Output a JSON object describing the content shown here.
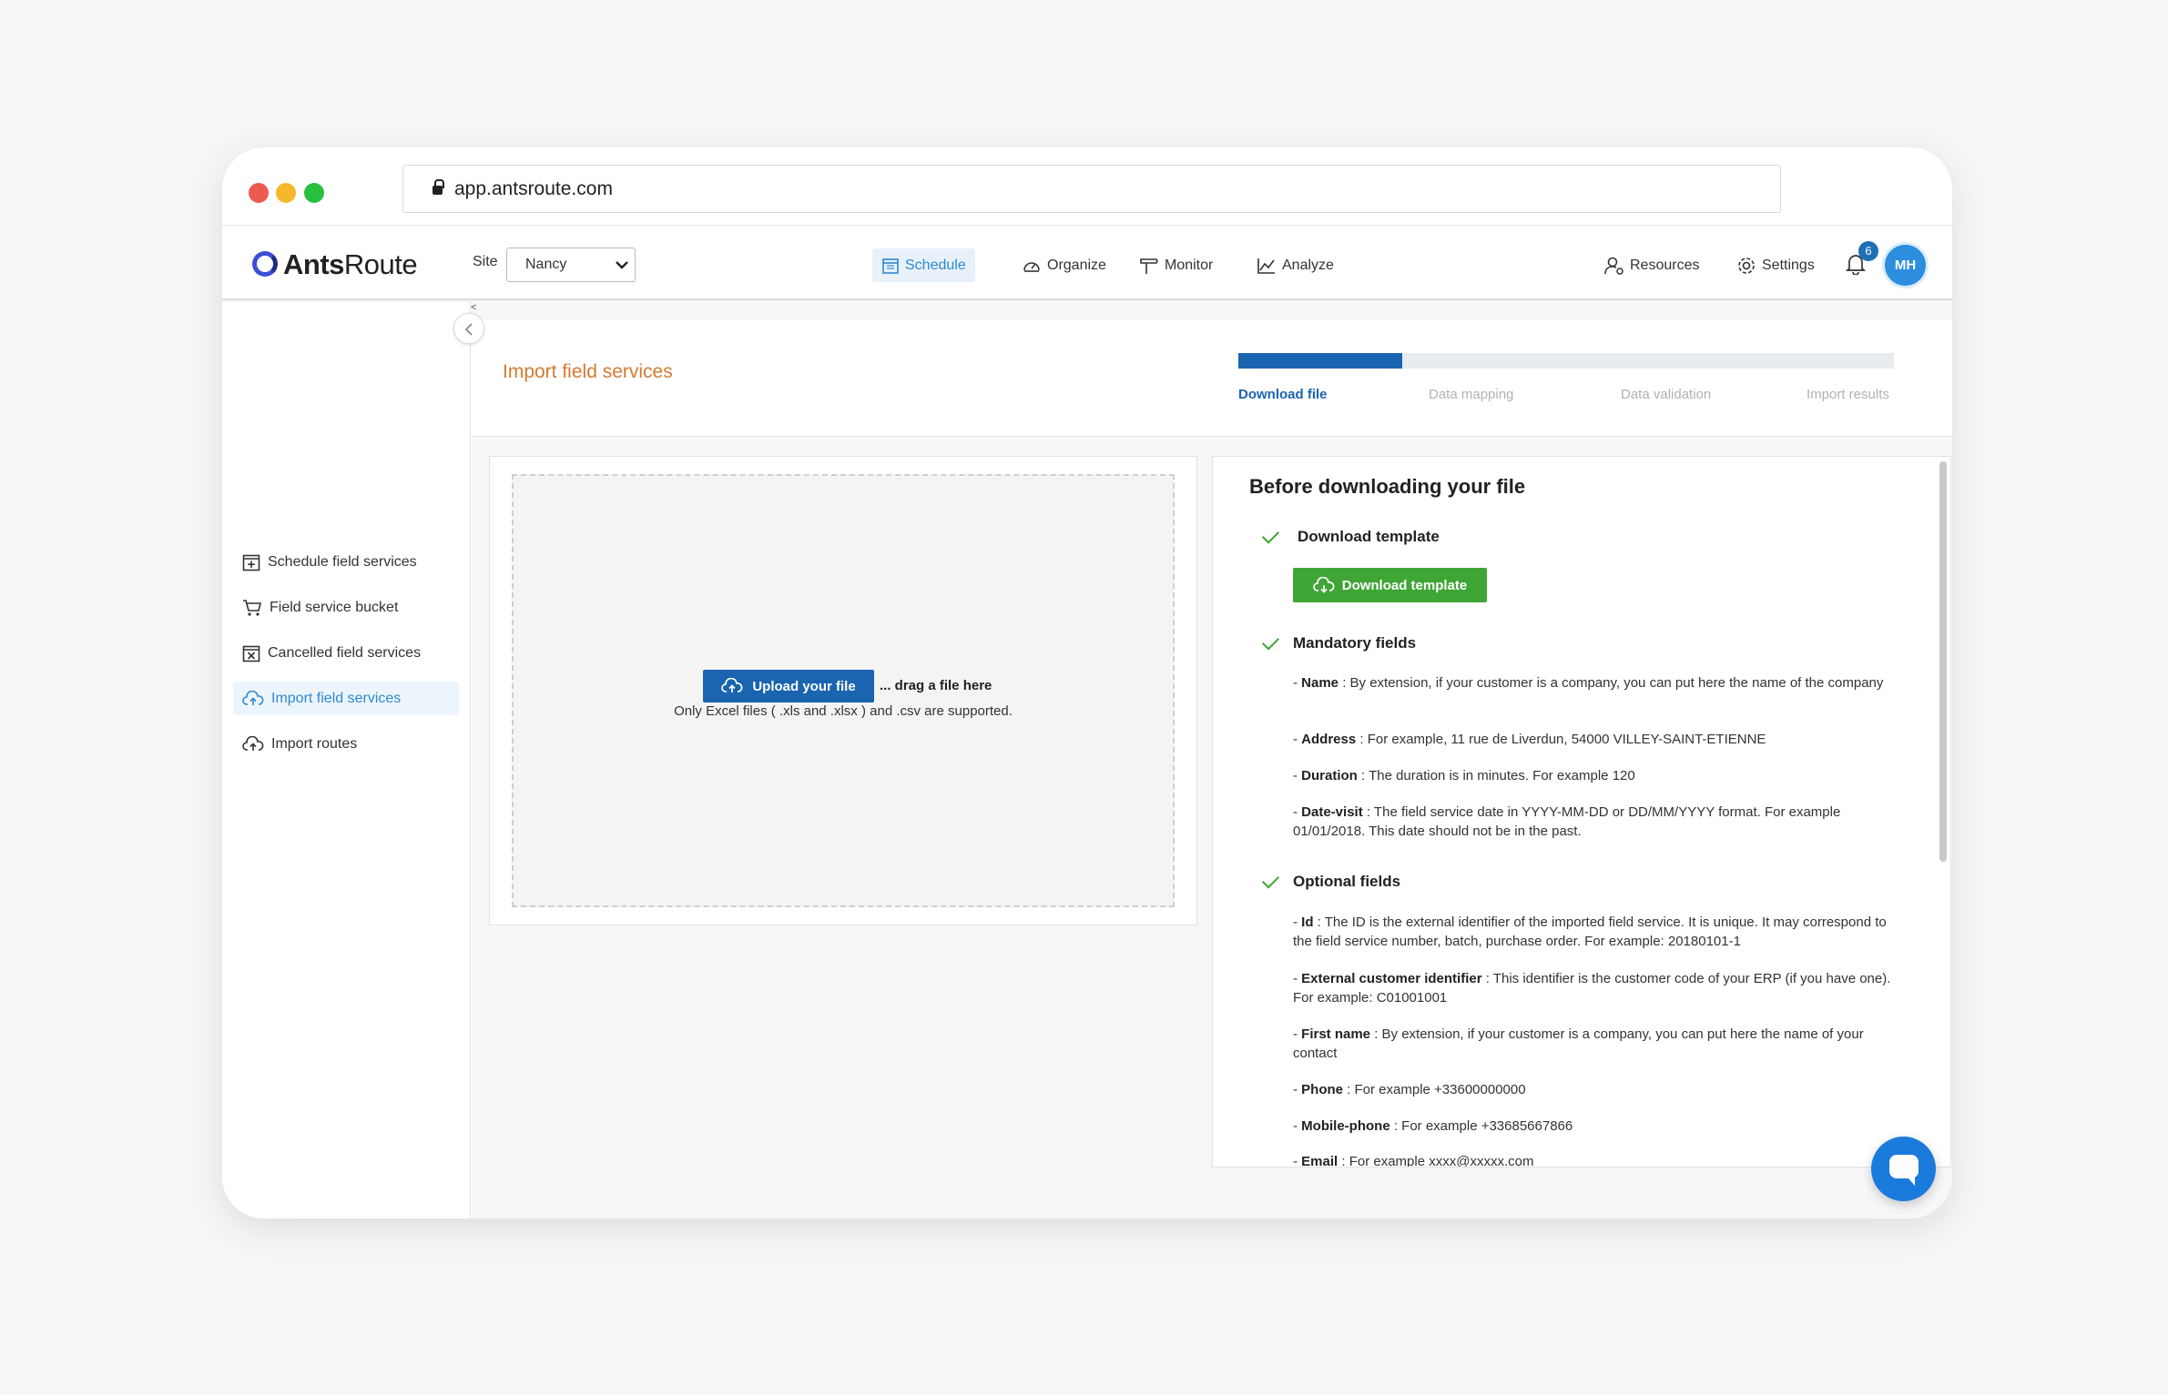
{
  "browser": {
    "url": "app.antsroute.com"
  },
  "app": {
    "logo_bold": "Ants",
    "logo_light": "Route"
  },
  "topnav": {
    "site_label": "Site",
    "site_value": "Nancy",
    "items": [
      {
        "label": "Schedule",
        "icon": "calendar-icon",
        "active": true
      },
      {
        "label": "Organize",
        "icon": "gauge-icon",
        "active": false
      },
      {
        "label": "Monitor",
        "icon": "signpost-icon",
        "active": false
      },
      {
        "label": "Analyze",
        "icon": "chart-icon",
        "active": false
      }
    ],
    "right_items": [
      {
        "label": "Resources",
        "icon": "user-gear-icon"
      },
      {
        "label": "Settings",
        "icon": "gear-icon"
      }
    ],
    "notification_count": "6",
    "avatar_initials": "MH"
  },
  "sidebar": {
    "items": [
      {
        "label": "Schedule field services",
        "icon": "calendar-plus-icon",
        "active": false
      },
      {
        "label": "Field service bucket",
        "icon": "cart-icon",
        "active": false
      },
      {
        "label": "Cancelled field services",
        "icon": "calendar-x-icon",
        "active": false
      },
      {
        "label": "Import field services",
        "icon": "cloud-upload-icon",
        "active": true
      },
      {
        "label": "Import routes",
        "icon": "cloud-upload-icon",
        "active": false
      }
    ],
    "collapse_caret": "<"
  },
  "page": {
    "title": "Import field services",
    "progress_fraction": 0.25,
    "steps": [
      {
        "label": "Download file",
        "current": true
      },
      {
        "label": "Data mapping",
        "current": false
      },
      {
        "label": "Data validation",
        "current": false
      },
      {
        "label": "Import results",
        "current": false
      }
    ]
  },
  "upload": {
    "button_label": "Upload your file",
    "drag_text": "... drag a file here",
    "support_text": "Only Excel files ( .xls and .xlsx ) and .csv are supported."
  },
  "info": {
    "title": "Before downloading your file",
    "download_section_title": "Download template",
    "download_button_label": "Download template",
    "mandatory_title": "Mandatory fields",
    "mandatory_fields": [
      {
        "name": "Name",
        "desc": " : By extension, if your customer is a company, you can put here the name of the company"
      },
      {
        "name": "Address",
        "desc": " : For example, 11 rue de Liverdun, 54000 VILLEY-SAINT-ETIENNE"
      },
      {
        "name": "Duration",
        "desc": " : The duration is in minutes. For example 120"
      },
      {
        "name": "Date-visit",
        "desc": " : The field service date in YYYY-MM-DD or DD/MM/YYYY format. For example 01/01/2018. This date should not be in the past."
      }
    ],
    "optional_title": "Optional fields",
    "optional_fields": [
      {
        "name": "Id",
        "desc": " : The ID is the external identifier of the imported field service. It is unique. It may correspond to the field service number, batch, purchase order. For example: 20180101-1"
      },
      {
        "name": "External customer identifier",
        "desc": " : This identifier is the customer code of your ERP (if you have one). For example: C01001001"
      },
      {
        "name": "First name",
        "desc": " : By extension, if your customer is a company, you can put here the name of your contact"
      },
      {
        "name": "Phone",
        "desc": " : For example +33600000000"
      },
      {
        "name": "Mobile-phone",
        "desc": " : For example +33685667866"
      },
      {
        "name": "Email",
        "desc": " : For example xxxx@xxxxx.com"
      }
    ],
    "prefix": "- "
  },
  "colors": {
    "accent_blue": "#1a64b0",
    "title_orange": "#d57a2f",
    "success_green": "#3fa535"
  }
}
